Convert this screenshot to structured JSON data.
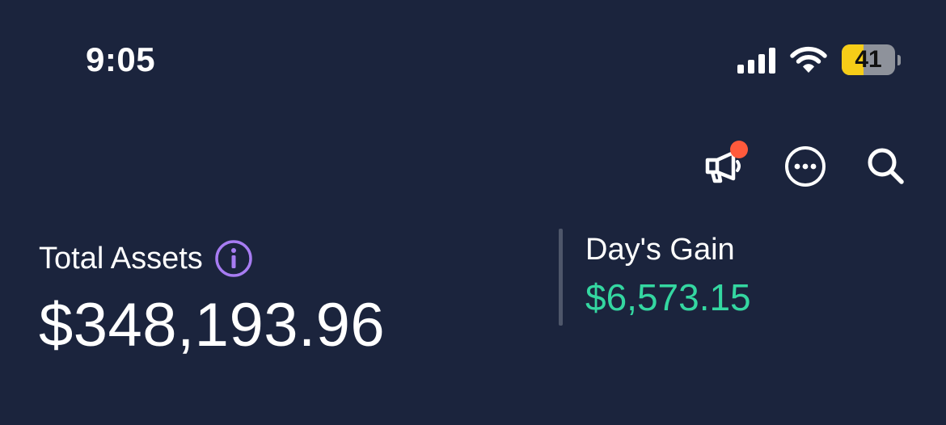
{
  "status_bar": {
    "time": "9:05",
    "signal_icon": "cellular-signal-icon",
    "wifi_icon": "wifi-icon",
    "battery_level": "41",
    "battery_percent": 0.41,
    "battery_color": "#f6cd18"
  },
  "toolbar": {
    "announcements_icon": "megaphone-icon",
    "announcements_badge_color": "#ff5a3c",
    "more_icon": "more-options-icon",
    "search_icon": "search-icon"
  },
  "summary": {
    "total_assets_label": "Total Assets",
    "total_assets_info_icon": "info-icon",
    "total_assets_value": "$348,193.96",
    "days_gain_label": "Day's Gain",
    "days_gain_value": "$6,573.15",
    "gain_color": "#34d7a1",
    "info_color": "#a77cf2"
  },
  "colors": {
    "background": "#1b243d",
    "text": "#ffffff"
  }
}
